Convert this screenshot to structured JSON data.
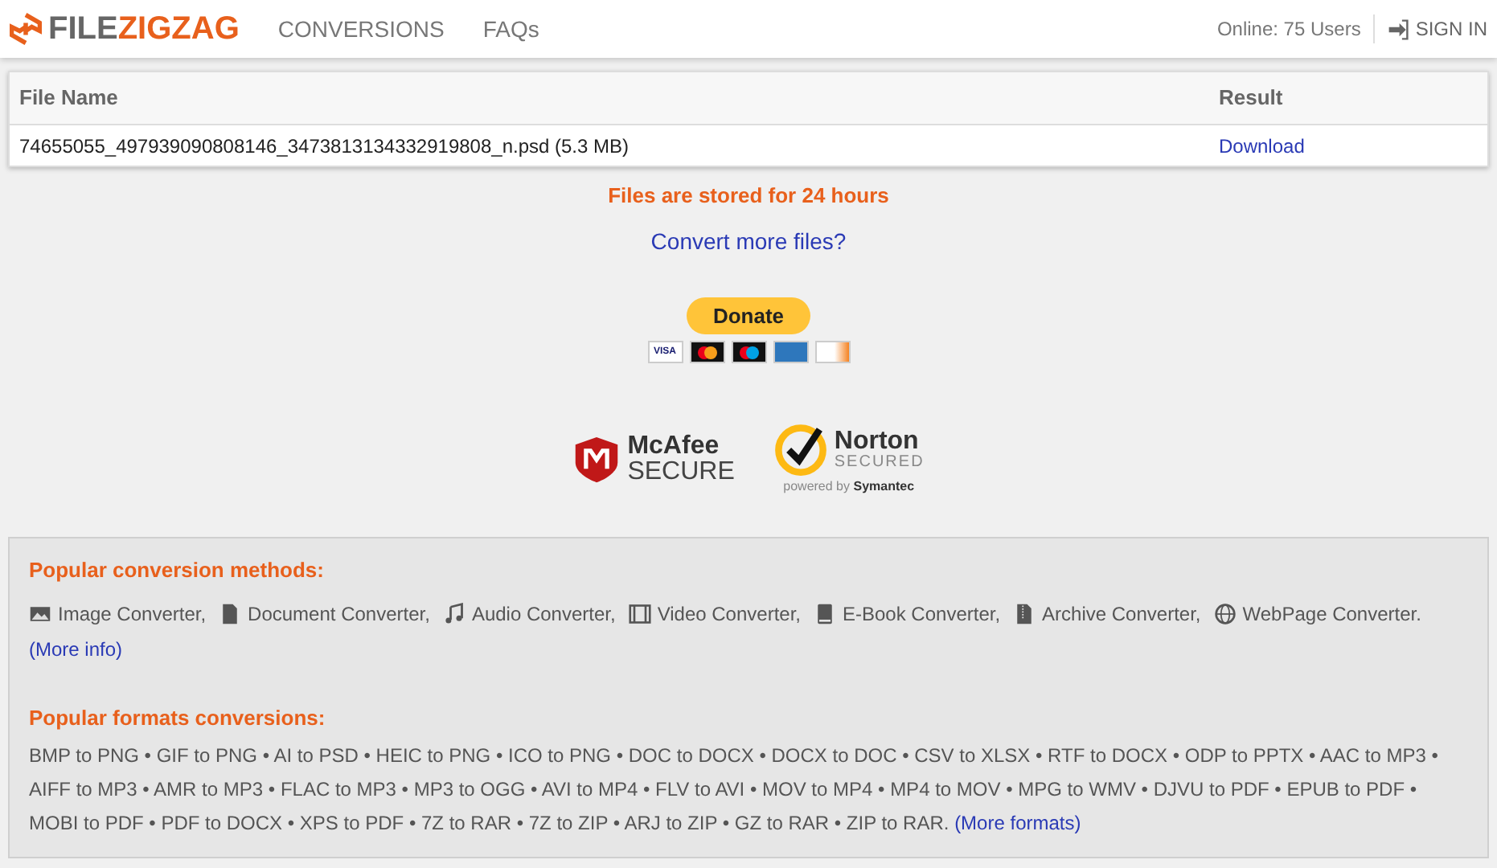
{
  "header": {
    "logo": {
      "part1": "FILE",
      "part2": "ZIGZAG"
    },
    "nav": [
      {
        "label": "CONVERSIONS"
      },
      {
        "label": "FAQs"
      }
    ],
    "online": "Online: 75 Users",
    "sign_in": "SIGN IN"
  },
  "table": {
    "columns": [
      "File Name",
      "Result"
    ],
    "rows": [
      {
        "file": "74655055_497939090808146_3473813134332919808_n.psd (5.3 MB)",
        "result": "Download"
      }
    ]
  },
  "notice": "Files are stored for 24 hours",
  "convert_more": "Convert more files?",
  "donate": {
    "label": "Donate",
    "cards": [
      {
        "kind": "visa",
        "label": "VISA"
      },
      {
        "kind": "mastercard"
      },
      {
        "kind": "maestro"
      },
      {
        "kind": "amex"
      },
      {
        "kind": "discover"
      }
    ]
  },
  "badges": {
    "mcafee": {
      "name": "McAfee",
      "sub": "SECURE"
    },
    "norton": {
      "name": "Norton",
      "sub": "SECURED",
      "powered": "powered by",
      "by": "Symantec"
    }
  },
  "methods": {
    "title": "Popular conversion methods:",
    "items": [
      {
        "label": "Image Converter,",
        "kind": "image"
      },
      {
        "label": "Document Converter,",
        "kind": "document"
      },
      {
        "label": "Audio Converter,",
        "kind": "audio"
      },
      {
        "label": "Video Converter,",
        "kind": "video"
      },
      {
        "label": "E-Book Converter,",
        "kind": "book"
      },
      {
        "label": "Archive Converter,",
        "kind": "archive"
      },
      {
        "label": "WebPage Converter.",
        "kind": "web"
      }
    ],
    "more": "(More info)"
  },
  "formats": {
    "title": "Popular formats conversions:",
    "text": "BMP to PNG • GIF to PNG • AI to PSD • HEIC to PNG • ICO to PNG • DOC to DOCX • DOCX to DOC • CSV to XLSX • RTF to DOCX • ODP to PPTX • AAC to MP3 • AIFF to MP3 • AMR to MP3 • FLAC to MP3 • MP3 to OGG • AVI to MP4 • FLV to AVI • MOV to MP4 • MP4 to MOV • MPG to WMV • DJVU to PDF • EPUB to PDF • MOBI to PDF • PDF to DOCX • XPS to PDF • 7Z to RAR • 7Z to ZIP • ARJ to ZIP • GZ to RAR • ZIP to RAR.",
    "more": "(More formats)"
  }
}
